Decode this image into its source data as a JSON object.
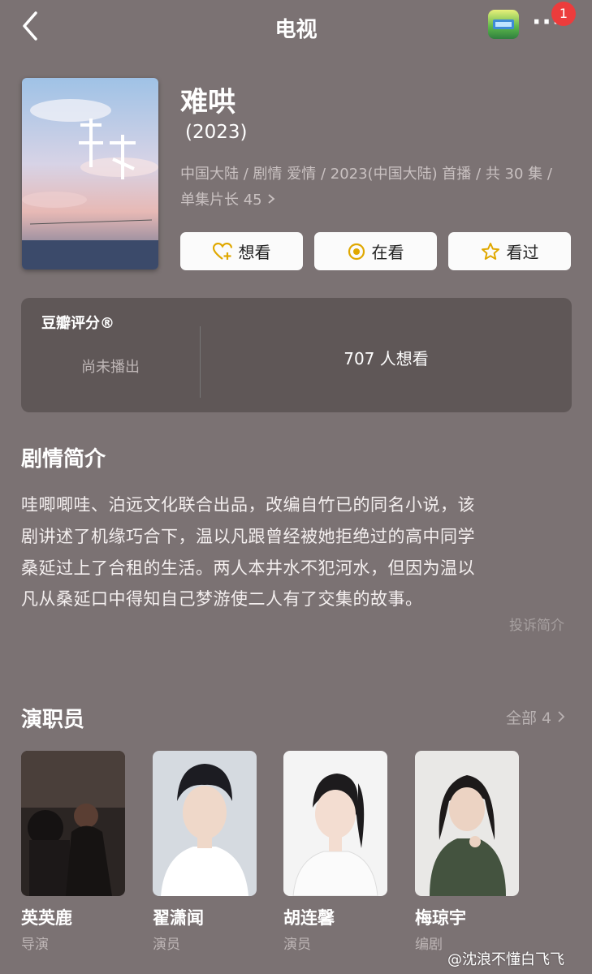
{
  "header": {
    "title": "电视",
    "notification_count": "1",
    "more_glyph": "···",
    "back_icon": "chevron-left-icon"
  },
  "show": {
    "title": "难哄",
    "year": "(2023)",
    "meta_line1": "中国大陆 / 剧情 爱情 / 2023(中国大陆) 首播 / 共 30 集 /",
    "meta_line2": "单集片长 45"
  },
  "actions": {
    "want_label": "想看",
    "watching_label": "在看",
    "watched_label": "看过"
  },
  "rating": {
    "label": "豆瓣评分®",
    "status": "尚未播出",
    "want_count": "707 人想看"
  },
  "synopsis": {
    "heading": "剧情简介",
    "lines": [
      "哇唧唧哇、泊远文化联合出品，改编自竹已的同名小说，该",
      "剧讲述了机缘巧合下，温以凡跟曾经被她拒绝过的高中同学",
      "桑延过上了合租的生活。两人本井水不犯河水，但因为温以",
      "凡从桑延口中得知自己梦游使二人有了交集的故事。"
    ],
    "report_label": "投诉简介"
  },
  "cast": {
    "heading": "演职员",
    "all_label": "全部 4",
    "members": [
      {
        "name": "英英鹿",
        "role": "导演"
      },
      {
        "name": "翟潇闻",
        "role": "演员"
      },
      {
        "name": "胡连馨",
        "role": "演员"
      },
      {
        "name": "梅琼宇",
        "role": "编剧"
      }
    ]
  },
  "watermark": "@沈浪不懂白飞飞",
  "colors": {
    "background": "#7b7273",
    "card": "#5f5757",
    "badge": "#ec3c3c",
    "accent": "#e0a800"
  }
}
